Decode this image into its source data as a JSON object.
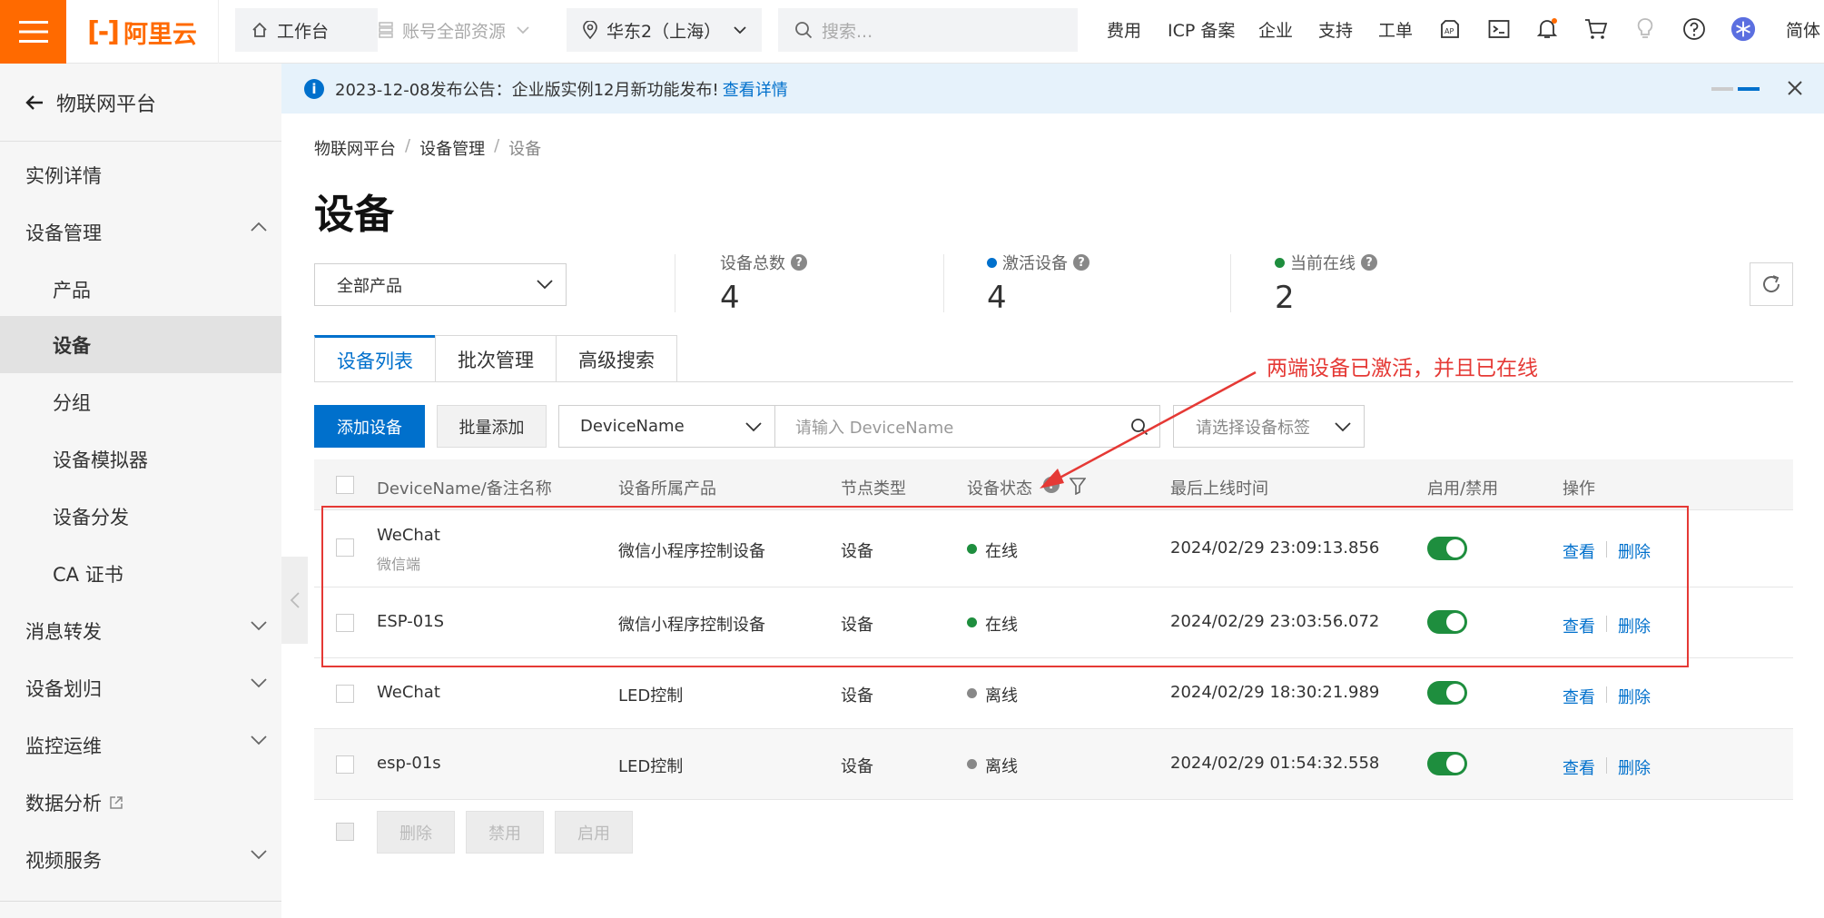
{
  "topbar": {
    "logo_text": "阿里云",
    "workbench": "工作台",
    "resources": "账号全部资源",
    "region": "华东2（上海）",
    "search_placeholder": "搜索...",
    "links": [
      "费用",
      "ICP 备案",
      "企业",
      "支持",
      "工单"
    ],
    "lang": "简体"
  },
  "sidebar": {
    "back_label": "物联网平台",
    "items": [
      {
        "label": "实例详情"
      },
      {
        "label": "设备管理"
      },
      {
        "label": "产品"
      },
      {
        "label": "设备"
      },
      {
        "label": "分组"
      },
      {
        "label": "设备模拟器"
      },
      {
        "label": "设备分发"
      },
      {
        "label": "CA 证书"
      },
      {
        "label": "消息转发"
      },
      {
        "label": "设备划归"
      },
      {
        "label": "监控运维"
      },
      {
        "label": "数据分析"
      },
      {
        "label": "视频服务"
      }
    ]
  },
  "notice": {
    "text": "2023-12-08发布公告：企业版实例12月新功能发布!",
    "link": "查看详情"
  },
  "breadcrumb": [
    "物联网平台",
    "设备管理",
    "设备"
  ],
  "page_title": "设备",
  "product_filter": "全部产品",
  "stats": {
    "total": {
      "label": "设备总数",
      "value": "4"
    },
    "activated": {
      "label": "激活设备",
      "value": "4",
      "color": "#0070cc"
    },
    "online": {
      "label": "当前在线",
      "value": "2",
      "color": "#1e8e3e"
    }
  },
  "tabs": [
    "设备列表",
    "批次管理",
    "高级搜索"
  ],
  "toolbar": {
    "add": "添加设备",
    "batch_add": "批量添加",
    "field_select": "DeviceName",
    "search_placeholder": "请输入 DeviceName",
    "tag_select": "请选择设备标签"
  },
  "table": {
    "headers": [
      "DeviceName/备注名称",
      "设备所属产品",
      "节点类型",
      "设备状态",
      "最后上线时间",
      "启用/禁用",
      "操作"
    ],
    "rows": [
      {
        "name": "WeChat",
        "note": "微信端",
        "product": "微信小程序控制设备",
        "node": "设备",
        "status": "在线",
        "status_color": "#1e8e3e",
        "last_online": "2024/02/29 23:09:13.856",
        "enabled": true,
        "view": "查看",
        "delete": "删除"
      },
      {
        "name": "ESP-01S",
        "note": "",
        "product": "微信小程序控制设备",
        "node": "设备",
        "status": "在线",
        "status_color": "#1e8e3e",
        "last_online": "2024/02/29 23:03:56.072",
        "enabled": true,
        "view": "查看",
        "delete": "删除"
      },
      {
        "name": "WeChat",
        "note": "",
        "product": "LED控制",
        "node": "设备",
        "status": "离线",
        "status_color": "#888888",
        "last_online": "2024/02/29 18:30:21.989",
        "enabled": true,
        "view": "查看",
        "delete": "删除"
      },
      {
        "name": "esp-01s",
        "note": "",
        "product": "LED控制",
        "node": "设备",
        "status": "离线",
        "status_color": "#888888",
        "last_online": "2024/02/29 01:54:32.558",
        "enabled": true,
        "view": "查看",
        "delete": "删除"
      }
    ]
  },
  "footer_buttons": [
    "删除",
    "禁用",
    "启用"
  ],
  "annotation": {
    "text": "两端设备已激活，并且已在线",
    "color": "#e53935"
  }
}
